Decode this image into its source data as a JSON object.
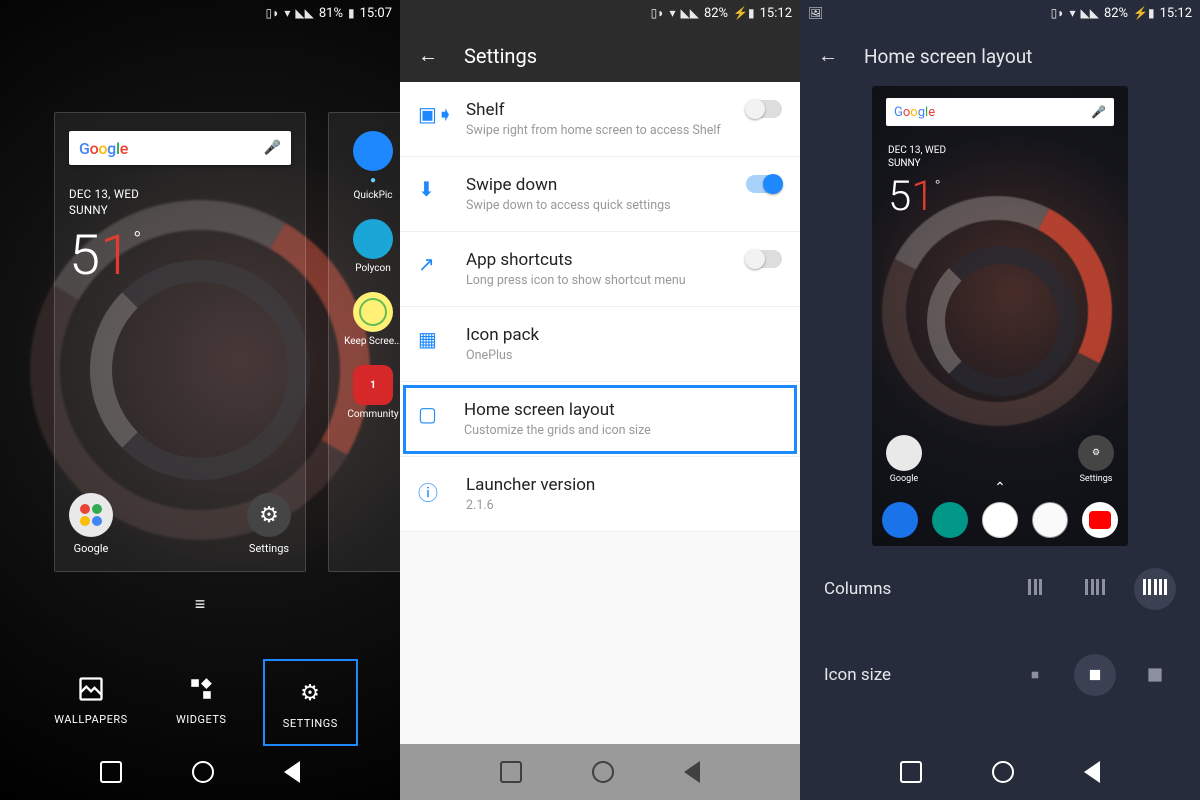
{
  "panel1": {
    "status": {
      "battery": "81%",
      "time": "15:07"
    },
    "search_label": "Google",
    "weather": {
      "date": "DEC 13, WED",
      "cond": "SUNNY",
      "t1": "5",
      "t2": "1",
      "deg": "°"
    },
    "home_apps": {
      "google": "Google",
      "settings": "Settings"
    },
    "side_apps": {
      "quickpic": "QuickPic",
      "polycon": "Polycon",
      "keep": "Keep Scree...",
      "community": "Community",
      "community_badge": "1"
    },
    "edit": {
      "wallpapers": "WALLPAPERS",
      "widgets": "WIDGETS",
      "settings": "SETTINGS"
    }
  },
  "panel2": {
    "status": {
      "battery": "82%",
      "time": "15:12"
    },
    "title": "Settings",
    "items": [
      {
        "t": "Shelf",
        "s": "Swipe right from home screen to access Shelf"
      },
      {
        "t": "Swipe down",
        "s": "Swipe down to access quick settings"
      },
      {
        "t": "App shortcuts",
        "s": "Long press icon to show shortcut menu"
      },
      {
        "t": "Icon pack",
        "s": "OnePlus"
      },
      {
        "t": "Home screen layout",
        "s": "Customize the grids and icon size"
      },
      {
        "t": "Launcher version",
        "s": "2.1.6"
      }
    ]
  },
  "panel3": {
    "status": {
      "battery": "82%",
      "time": "15:12"
    },
    "title": "Home screen layout",
    "preview": {
      "search": "Google",
      "date": "DEC 13, WED",
      "cond": "SUNNY",
      "t1": "5",
      "t2": "1",
      "deg": "°",
      "google": "Google",
      "settings": "Settings"
    },
    "rows": {
      "columns": "Columns",
      "iconsize": "Icon size"
    }
  }
}
